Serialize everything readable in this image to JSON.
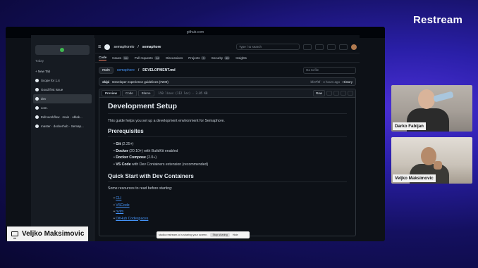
{
  "brand": "Restream",
  "browser": {
    "url": "github.com",
    "time_label": "Today",
    "new_tab": "+ New Tab",
    "tabs": [
      "Scope for 1.4",
      "Good first issue",
      "dev",
      "com.",
      "Edit workflow · main · oblak...",
      "master · dockerhub · Semap..."
    ]
  },
  "github": {
    "owner": "semaphoreio",
    "repo": "semaphore",
    "search_placeholder": "Type / to search",
    "nav": [
      {
        "label": "Code",
        "count": ""
      },
      {
        "label": "Issues",
        "count": "54"
      },
      {
        "label": "Pull requests",
        "count": "14"
      },
      {
        "label": "Discussions",
        "count": ""
      },
      {
        "label": "Projects",
        "count": "3"
      },
      {
        "label": "Security",
        "count": "65"
      },
      {
        "label": "Insights",
        "count": ""
      }
    ],
    "branch": "main",
    "path_repo": "semaphore",
    "path_file": "DEVELOPMENT.md",
    "goto_file": "Go to file",
    "commit": {
      "author": "skipi",
      "message": "Developer experience guidelines (#209)",
      "hash": "bf27f6f · 4 hours ago",
      "history": "History"
    },
    "file_tabs": [
      "Preview",
      "Code",
      "Blame"
    ],
    "file_meta": "150 lines (112 loc) · 3.85 KB",
    "raw": "Raw"
  },
  "doc": {
    "title": "Development Setup",
    "intro": "This guide helps you set up a development environment for Semaphore.",
    "prereq_heading": "Prerequisites",
    "prereqs": [
      {
        "name": "Git",
        "detail": " (2.25+)"
      },
      {
        "name": "Docker",
        "detail": " (20.10+) with BuildKit enabled"
      },
      {
        "name": "Docker Compose",
        "detail": " (2.0+)"
      },
      {
        "name": "VS Code",
        "detail": " with Dev Containers extension (recommended)"
      }
    ],
    "quickstart_heading": "Quick Start with Dev Containers",
    "quickstart_intro": "Some resources to read before starting:",
    "links": [
      "CLI",
      "VSCode",
      "nvim",
      "DitHub Codespaces"
    ]
  },
  "share_bar": {
    "text": "studio.restream.io is sharing your screen.",
    "stop": "Stop sharing",
    "hide": "Hide"
  },
  "presenter": "Veljko Maksimovic",
  "cams": [
    {
      "name": "Darko Fabijan"
    },
    {
      "name": "Veljko Maksimovic"
    }
  ]
}
